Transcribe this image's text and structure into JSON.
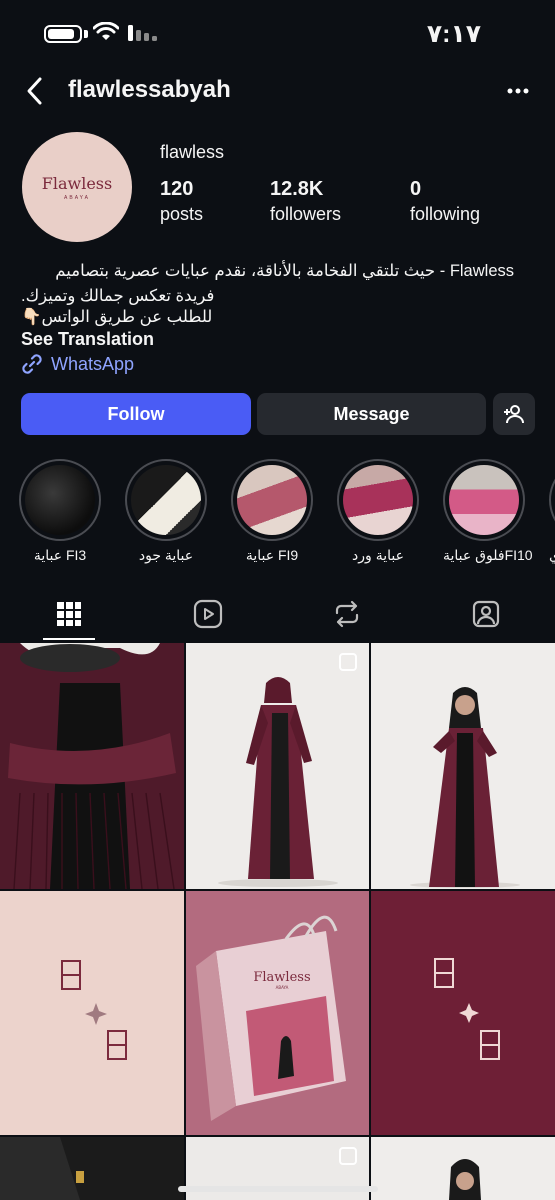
{
  "status": {
    "time": "٧:١٧",
    "battery_level": 0.85
  },
  "header": {
    "username": "flawlessabyah"
  },
  "profile": {
    "avatar_brand": "Flawless",
    "avatar_sub": "ABAYA",
    "display_name": "flawless",
    "stats": [
      {
        "value": "120",
        "label": "posts"
      },
      {
        "value": "12.8K",
        "label": "followers"
      },
      {
        "value": "0",
        "label": "following"
      }
    ]
  },
  "bio": {
    "lines": [
      "Flawless - حيث تلتقي الفخامة بالأناقة، نقدم عبايات عصرية بتصاميم",
      "فريدة تعكس جمالك وتميزك.",
      "للطلب عن طريق الواتس👇🏻"
    ],
    "see_translation": "See Translation",
    "link": "WhatsApp"
  },
  "actions": {
    "follow": "Follow",
    "message": "Message"
  },
  "highlights": [
    {
      "label": "عباية FI3"
    },
    {
      "label": "عباية جود"
    },
    {
      "label": "عباية FI9"
    },
    {
      "label": "عباية ورد"
    },
    {
      "label": "فلوق عبايةFI10"
    },
    {
      "label": "عباي"
    }
  ],
  "tabs": [
    "grid-icon",
    "reels-icon",
    "reposts-icon",
    "tagged-icon"
  ],
  "grid": {
    "brand_on_bag": "Flawless",
    "brand_on_bag_sub": "ABAYA"
  },
  "colors": {
    "background": "#0c0f14",
    "follow_button": "#4a5cf5",
    "link": "#8fa4ff",
    "maroon": "#6e1f36",
    "blush": "#ecd3cc"
  }
}
